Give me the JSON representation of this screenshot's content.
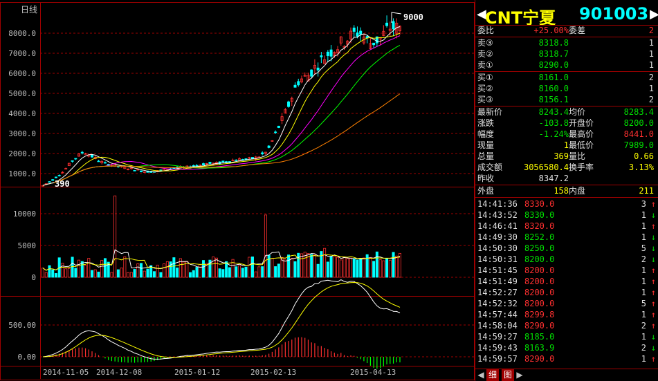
{
  "chart": {
    "period_label": "日线",
    "price_axis": [
      "8000.0",
      "7000.0",
      "6000.0",
      "5000.0",
      "4000.0",
      "3000.0",
      "2000.0",
      "1000.0"
    ],
    "volume_axis": [
      "10000",
      "5000",
      "0"
    ],
    "macd_axis": [
      "500.00",
      "0.00"
    ],
    "dates": [
      "2014-11-05",
      "2014-12-08",
      "2015-01-12",
      "2015-02-13",
      "2015-04-13"
    ],
    "high_marker": "9000",
    "low_marker": "390"
  },
  "chart_data": {
    "type": "candlestick",
    "title": "日线",
    "ylim": [
      390,
      9000
    ],
    "price_close_approx": [
      400,
      700,
      1100,
      1700,
      2100,
      1800,
      1500,
      1400,
      1300,
      1200,
      1100,
      1100,
      1200,
      1300,
      1300,
      1400,
      1500,
      1500,
      1600,
      1700,
      1700,
      1800,
      2100,
      3200,
      4300,
      5600,
      5900,
      6500,
      7000,
      7400,
      7800,
      8100,
      7500,
      7700,
      8300,
      8243
    ],
    "volume_axis_range": [
      0,
      13000
    ],
    "volume_peaks": [
      {
        "date": "2014-11-27",
        "value": 12800
      },
      {
        "date": "2015-01-23",
        "value": 9800
      }
    ],
    "macd_range": [
      -150,
      950
    ]
  },
  "quote": {
    "symbol_name": "CNT宁夏",
    "symbol_code": "901003",
    "weibi_label": "委比",
    "weibi_value": "+25.00%",
    "weicha_label": "委差",
    "weicha_value": "2",
    "sell": [
      {
        "label": "卖③",
        "price": "8318.8",
        "vol": "1"
      },
      {
        "label": "卖②",
        "price": "8318.7",
        "vol": "1"
      },
      {
        "label": "卖①",
        "price": "8290.0",
        "vol": "1"
      }
    ],
    "buy": [
      {
        "label": "买①",
        "price": "8161.0",
        "vol": "2"
      },
      {
        "label": "买②",
        "price": "8160.0",
        "vol": "1"
      },
      {
        "label": "买③",
        "price": "8156.1",
        "vol": "2"
      }
    ],
    "stats": [
      {
        "l1": "最新价",
        "v1": "8243.4",
        "l2": "均价",
        "v2": "8283.4"
      },
      {
        "l1": "涨跌",
        "v1": "-103.8",
        "l2": "开盘价",
        "v2": "8200.0"
      },
      {
        "l1": "幅度",
        "v1": "-1.24%",
        "l2": "最高价",
        "v2": "8441.0"
      },
      {
        "l1": "现量",
        "v1": "1",
        "l2": "最低价",
        "v2": "7989.0"
      },
      {
        "l1": "总量",
        "v1": "369",
        "l2": "量比",
        "v2": "0.66"
      },
      {
        "l1": "成交额",
        "v1": "3056580.4",
        "l2": "换手率",
        "v2": "3.13%"
      }
    ],
    "prev_close_label": "昨收",
    "prev_close_value": "8347.2",
    "outer_label": "外盘",
    "outer_value": "158",
    "inner_label": "内盘",
    "inner_value": "211"
  },
  "ticks": [
    {
      "time": "14:41:36",
      "price": "8330.0",
      "vol": "3",
      "dir": "up"
    },
    {
      "time": "14:43:52",
      "price": "8330.0",
      "vol": "1",
      "dir": "down"
    },
    {
      "time": "14:46:41",
      "price": "8320.0",
      "vol": "1",
      "dir": "up"
    },
    {
      "time": "14:49:30",
      "price": "8252.0",
      "vol": "1",
      "dir": "down"
    },
    {
      "time": "14:50:30",
      "price": "8250.0",
      "vol": "5",
      "dir": "down"
    },
    {
      "time": "14:50:31",
      "price": "8200.0",
      "vol": "2",
      "dir": "down"
    },
    {
      "time": "14:51:45",
      "price": "8200.0",
      "vol": "1",
      "dir": "up"
    },
    {
      "time": "14:51:49",
      "price": "8200.0",
      "vol": "1",
      "dir": "up"
    },
    {
      "time": "14:52:27",
      "price": "8200.0",
      "vol": "1",
      "dir": "up"
    },
    {
      "time": "14:52:32",
      "price": "8200.0",
      "vol": "5",
      "dir": "up"
    },
    {
      "time": "14:57:44",
      "price": "8299.8",
      "vol": "1",
      "dir": "up"
    },
    {
      "time": "14:58:04",
      "price": "8290.0",
      "vol": "2",
      "dir": "up"
    },
    {
      "time": "14:59:27",
      "price": "8185.0",
      "vol": "1",
      "dir": "down"
    },
    {
      "time": "14:59:43",
      "price": "8163.9",
      "vol": "2",
      "dir": "down"
    },
    {
      "time": "14:59:57",
      "price": "8290.0",
      "vol": "1",
      "dir": "up"
    }
  ],
  "tabs": {
    "detail": "细",
    "chart": "图"
  },
  "colors": {
    "up": "#ff3030",
    "down": "#00ffff",
    "grid": "#a00000",
    "ma5": "#ffffff",
    "ma10": "#ffff00",
    "ma20": "#ff00ff",
    "ma30": "#00ff00",
    "ma60": "#ff8000"
  }
}
